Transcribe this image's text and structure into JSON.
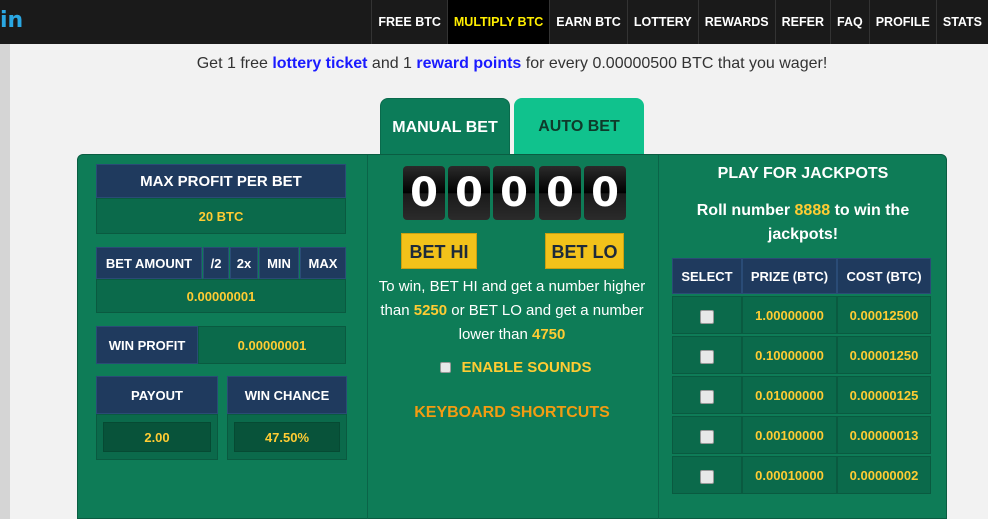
{
  "logo_fragment": "in",
  "nav": {
    "items": [
      {
        "label": "FREE BTC",
        "active": false
      },
      {
        "label": "MULTIPLY BTC",
        "active": true
      },
      {
        "label": "EARN BTC",
        "active": false
      },
      {
        "label": "LOTTERY",
        "active": false
      },
      {
        "label": "REWARDS",
        "active": false
      },
      {
        "label": "REFER",
        "active": false
      },
      {
        "label": "FAQ",
        "active": false
      },
      {
        "label": "PROFILE",
        "active": false
      },
      {
        "label": "STATS",
        "active": false
      }
    ]
  },
  "banner": {
    "prefix": "Get 1 free ",
    "lottery_link": "lottery ticket",
    "middle": " and 1 ",
    "reward_link": "reward points",
    "suffix": " for every 0.00000500 BTC that you wager!"
  },
  "tabs": {
    "manual": "MANUAL BET",
    "auto": "AUTO BET"
  },
  "left": {
    "max_profit_label": "MAX PROFIT PER BET",
    "max_profit_value": "20 BTC",
    "bet_amount_label": "BET AMOUNT",
    "half_label": "/2",
    "double_label": "2x",
    "min_label": "MIN",
    "max_label": "MAX",
    "bet_amount_value": "0.00000001",
    "win_profit_label": "WIN PROFIT",
    "win_profit_value": "0.00000001",
    "payout_label": "PAYOUT",
    "payout_value": "2.00",
    "win_chance_label": "WIN CHANCE",
    "win_chance_value": "47.50%"
  },
  "center": {
    "digits": [
      "0",
      "0",
      "0",
      "0",
      "0"
    ],
    "bet_hi": "BET HI",
    "bet_lo": "BET LO",
    "rule_1": "To win, BET HI and get a number higher",
    "rule_2a": "than ",
    "hi_number": "5250",
    "rule_2b": " or BET LO and get a number",
    "rule_3a": "lower than ",
    "lo_number": "4750",
    "sounds_label": "ENABLE SOUNDS",
    "shortcuts_label": "KEYBOARD SHORTCUTS"
  },
  "jackpot": {
    "title": "PLAY FOR JACKPOTS",
    "roll_prefix": "Roll number ",
    "roll_number": "8888",
    "roll_suffix": " to win the",
    "roll_line2": "jackpots!",
    "columns": [
      "SELECT",
      "PRIZE (BTC)",
      "COST (BTC)"
    ],
    "rows": [
      {
        "prize": "1.00000000",
        "cost": "0.00012500"
      },
      {
        "prize": "0.10000000",
        "cost": "0.00001250"
      },
      {
        "prize": "0.01000000",
        "cost": "0.00000125"
      },
      {
        "prize": "0.00100000",
        "cost": "0.00000013"
      },
      {
        "prize": "0.00010000",
        "cost": "0.00000002"
      }
    ]
  },
  "colors": {
    "panel_green": "#0e7c57",
    "navy_header": "#1f3a5e",
    "gold_text": "#ffcc33",
    "bet_button": "#f2c21a",
    "active_nav_text": "#ffee00",
    "shortcut_orange": "#f39c12"
  }
}
